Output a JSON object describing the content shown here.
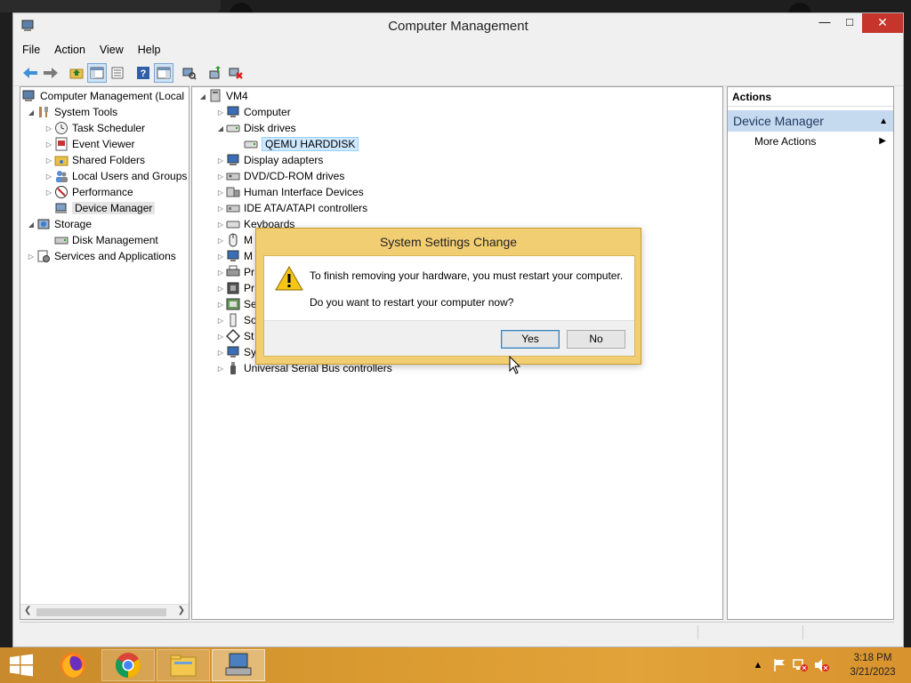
{
  "window": {
    "title": "Computer Management"
  },
  "menu": [
    "File",
    "Action",
    "View",
    "Help"
  ],
  "left_tree": [
    {
      "label": "Computer Management (Local",
      "icon": "computer-management-icon"
    },
    {
      "label": "System Tools",
      "icon": "system-tools-icon"
    },
    {
      "label": "Task Scheduler",
      "icon": "task-scheduler-icon"
    },
    {
      "label": "Event Viewer",
      "icon": "event-viewer-icon"
    },
    {
      "label": "Shared Folders",
      "icon": "shared-folders-icon"
    },
    {
      "label": "Local Users and Groups",
      "icon": "users-icon"
    },
    {
      "label": "Performance",
      "icon": "performance-icon"
    },
    {
      "label": "Device Manager",
      "icon": "device-manager-icon"
    },
    {
      "label": "Storage",
      "icon": "storage-icon"
    },
    {
      "label": "Disk Management",
      "icon": "disk-management-icon"
    },
    {
      "label": "Services and Applications",
      "icon": "services-icon"
    }
  ],
  "device_tree": [
    {
      "label": "VM4",
      "icon": "computer-icon"
    },
    {
      "label": "Computer",
      "icon": "monitor-icon"
    },
    {
      "label": "Disk drives",
      "icon": "disk-drive-icon"
    },
    {
      "label": "QEMU HARDDISK",
      "icon": "disk-drive-icon"
    },
    {
      "label": "Display adapters",
      "icon": "display-adapter-icon"
    },
    {
      "label": "DVD/CD-ROM drives",
      "icon": "dvd-icon"
    },
    {
      "label": "Human Interface Devices",
      "icon": "hid-icon"
    },
    {
      "label": "IDE ATA/ATAPI controllers",
      "icon": "ide-icon"
    },
    {
      "label": "Keyboards",
      "icon": "keyboard-icon"
    },
    {
      "label": "M",
      "icon": "mouse-icon"
    },
    {
      "label": "M",
      "icon": "monitor-icon"
    },
    {
      "label": "Pr",
      "icon": "printer-icon"
    },
    {
      "label": "Pr",
      "icon": "processor-icon"
    },
    {
      "label": "Se",
      "icon": "sensor-icon"
    },
    {
      "label": "So",
      "icon": "sound-icon"
    },
    {
      "label": "St",
      "icon": "storage-controller-icon"
    },
    {
      "label": "Sy",
      "icon": "system-devices-icon"
    },
    {
      "label": "Universal Serial Bus controllers",
      "icon": "usb-icon"
    }
  ],
  "actions": {
    "header": "Actions",
    "section": "Device Manager",
    "item": "More Actions"
  },
  "dialog": {
    "title": "System Settings Change",
    "message1": "To finish removing your hardware, you must restart your computer.",
    "message2": "Do you want to restart your computer now?",
    "yes": "Yes",
    "no": "No"
  },
  "clock": {
    "time": "3:18 PM",
    "date": "3/21/2023"
  },
  "colors": {
    "dialog_frame": "#f2ce73",
    "taskbar": "#d99a30",
    "close_button": "#c7342b",
    "actions_section": "#c5d9ef"
  }
}
